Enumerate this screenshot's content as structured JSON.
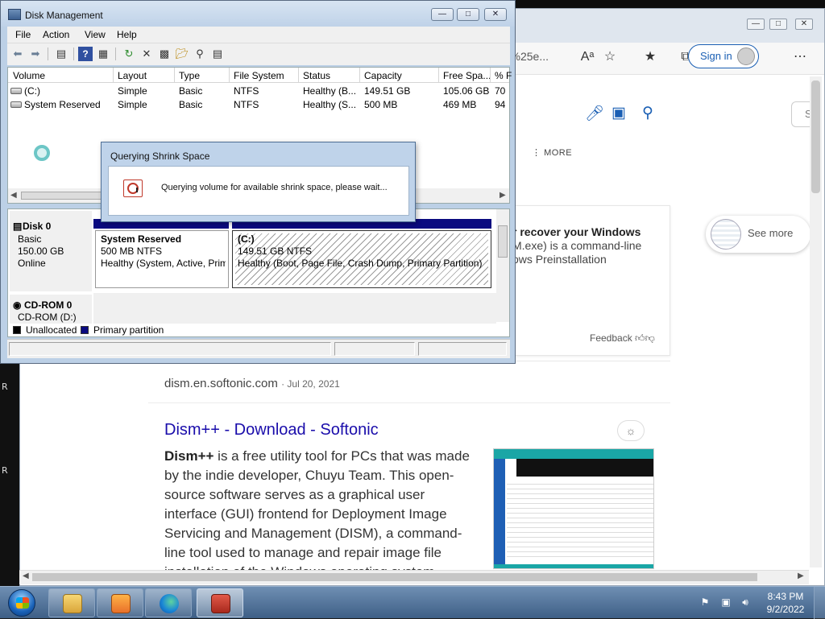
{
  "colors": {
    "primary_partition": "#0a0a80",
    "unallocated": "#000000",
    "link": "#1a0dab",
    "accent": "#1a5fb4"
  },
  "desktop": {
    "left_letters": [
      "R",
      "R"
    ]
  },
  "browser": {
    "url_fragment": "&=%25e...",
    "signin_label": "Sign in",
    "more_label": "MORE",
    "search_box_fragment": "S",
    "info_card": {
      "title": "r recover your Windows",
      "line1": "M.exe) is a command-line",
      "line2": "ows Preinstallation",
      "feedback": "Feedback"
    },
    "see_more": "See more",
    "result": {
      "site": "dism.en.softonic.com",
      "date": "Jul 20, 2021",
      "title": "Dism++ - Download - Softonic",
      "snippet_bold": "Dism++",
      "snippet_rest": " is a free utility tool for PCs that was made by the indie developer, Chuyu Team. This open-source software serves as a graphical user interface (GUI) frontend for Deployment Image Servicing and Management (DISM), a command-line tool used to manage and repair image file installation of the Windows operating system"
    }
  },
  "disk_management": {
    "title": "Disk Management",
    "menu": [
      "File",
      "Action",
      "View",
      "Help"
    ],
    "columns": [
      "Volume",
      "Layout",
      "Type",
      "File System",
      "Status",
      "Capacity",
      "Free Spa...",
      "% F"
    ],
    "volumes": [
      {
        "volume": "(C:)",
        "layout": "Simple",
        "type": "Basic",
        "fs": "NTFS",
        "status": "Healthy (B...",
        "capacity": "149.51 GB",
        "free": "105.06 GB",
        "pct": "70"
      },
      {
        "volume": "System Reserved",
        "layout": "Simple",
        "type": "Basic",
        "fs": "NTFS",
        "status": "Healthy (S...",
        "capacity": "500 MB",
        "free": "469 MB",
        "pct": "94"
      }
    ],
    "disks": [
      {
        "name": "Disk 0",
        "kind": "Basic",
        "size": "150.00 GB",
        "state": "Online"
      },
      {
        "name": "CD-ROM 0",
        "kind": "CD-ROM (D:)"
      }
    ],
    "partitions": [
      {
        "name": "System Reserved",
        "size": "500 MB NTFS",
        "status": "Healthy (System, Active, Primary Partition)"
      },
      {
        "name": "(C:)",
        "size": "149.51 GB NTFS",
        "status": "Healthy (Boot, Page File, Crash Dump, Primary Partition)"
      }
    ],
    "legend": [
      "Unallocated",
      "Primary partition"
    ]
  },
  "dialog": {
    "title": "Querying Shrink Space",
    "message": "Querying volume for available shrink space, please wait..."
  },
  "taskbar": {
    "time": "8:43 PM",
    "date": "9/2/2022"
  }
}
